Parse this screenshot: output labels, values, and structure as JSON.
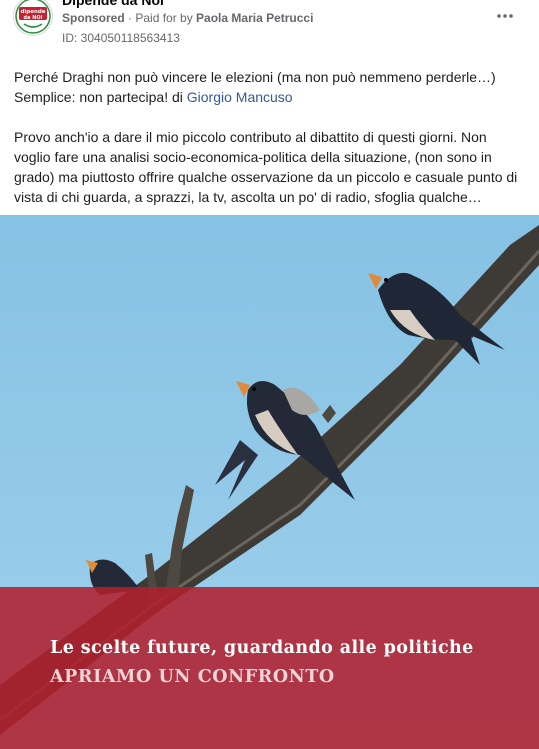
{
  "header": {
    "page_name": "Dipende da Noi",
    "sponsored_label": "Sponsored",
    "separator": " · ",
    "paid_for_label": "Paid for by ",
    "payer": "Paola Maria Petrucci",
    "ad_id": "ID: 304050118563413",
    "more_icon": "more-horizontal-icon",
    "avatar_logo_text_top": "dipende",
    "avatar_logo_text_bottom": "da NOI"
  },
  "body": {
    "line1_text": "Perché Draghi non può vincere le elezioni (ma non può nemmeno perderle…) Semplice: non partecipa! di ",
    "author_link": "Giorgio Mancuso",
    "paragraph2": "Provo anch'io a dare il mio piccolo contributo al dibattito di questi giorni. Non voglio fare una analisi socio-economica-politica della situazione, (non sono in grado) ma piuttosto offrire qualche osservazione da un piccolo e casuale punto di vista di chi guarda, a sprazzi, la tv, ascolta un po' di radio, sfoglia qualche…"
  },
  "media": {
    "banner_line1": "Le scelte future, guardando alle politiche",
    "banner_line2": "APRIAMO UN CONFRONTO",
    "sky_color": "#8ec7e6",
    "banner_color": "#b0202e"
  }
}
